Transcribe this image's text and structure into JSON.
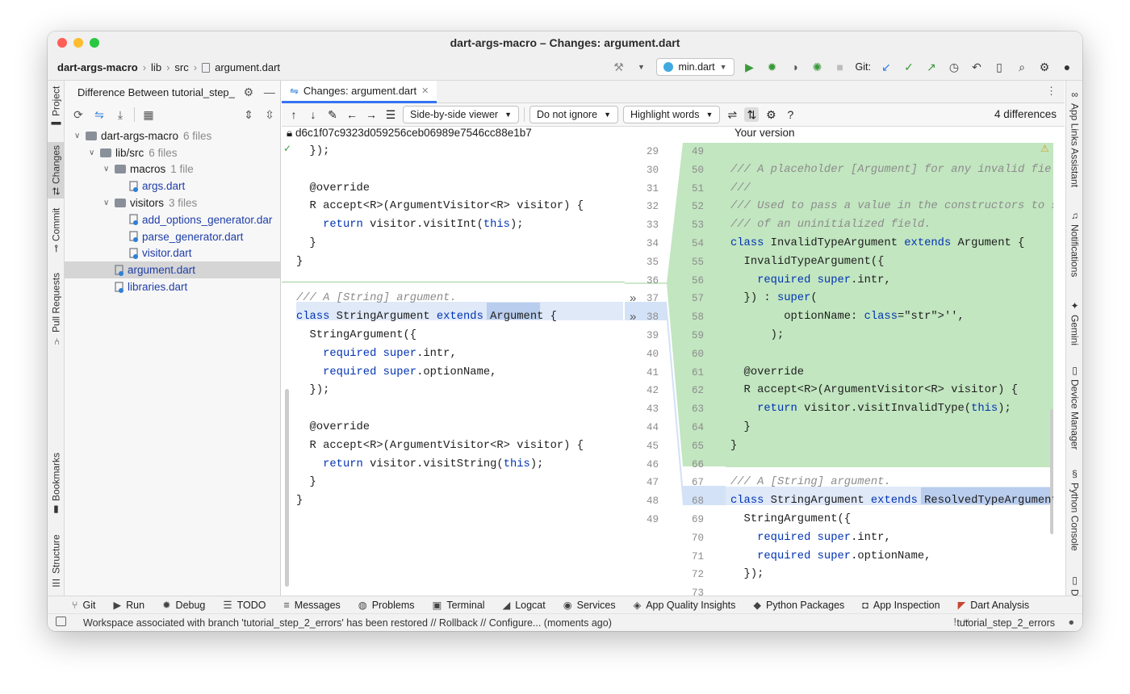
{
  "window": {
    "title": "dart-args-macro – Changes: argument.dart",
    "colors": {
      "close": "#ff5f57",
      "minimize": "#febc2e",
      "zoom": "#28c840",
      "accent": "#3574f0",
      "added_bg": "#c2e6c0",
      "changed_bg": "#d4e2f7"
    }
  },
  "breadcrumbs": [
    "dart-args-macro",
    "lib",
    "src",
    "argument.dart"
  ],
  "toolbar": {
    "run_config": "min.dart",
    "git_label": "Git:"
  },
  "left_tools": [
    {
      "label": "Project",
      "icon": "folder-icon"
    },
    {
      "label": "Changes",
      "icon": "changes-icon"
    },
    {
      "label": "Commit",
      "icon": "commit-icon"
    },
    {
      "label": "Pull Requests",
      "icon": "pull-request-icon"
    },
    {
      "label": "Bookmarks",
      "icon": "bookmark-icon"
    },
    {
      "label": "Structure",
      "icon": "structure-icon"
    }
  ],
  "right_tools": [
    {
      "label": "App Links Assistant",
      "icon": "link-icon"
    },
    {
      "label": "Notifications",
      "icon": "bell-icon"
    },
    {
      "label": "Gemini",
      "icon": "sparkle-icon"
    },
    {
      "label": "Device Manager",
      "icon": "device-icon"
    },
    {
      "label": "Python Console",
      "icon": "python-icon"
    },
    {
      "label": "D",
      "icon": "device-icon"
    }
  ],
  "project": {
    "title": "Difference Between tutorial_step_",
    "tree": [
      {
        "label": "dart-args-macro",
        "count": "6 files",
        "level": 0,
        "kind": "module",
        "expanded": true
      },
      {
        "label": "lib/src",
        "count": "6 files",
        "level": 1,
        "kind": "folder",
        "expanded": true
      },
      {
        "label": "macros",
        "count": "1 file",
        "level": 2,
        "kind": "folder",
        "expanded": true
      },
      {
        "label": "args.dart",
        "count": "",
        "level": 3,
        "kind": "file"
      },
      {
        "label": "visitors",
        "count": "3 files",
        "level": 2,
        "kind": "folder",
        "expanded": true
      },
      {
        "label": "add_options_generator.dar",
        "count": "",
        "level": 3,
        "kind": "file"
      },
      {
        "label": "parse_generator.dart",
        "count": "",
        "level": 3,
        "kind": "file"
      },
      {
        "label": "visitor.dart",
        "count": "",
        "level": 3,
        "kind": "file"
      },
      {
        "label": "argument.dart",
        "count": "",
        "level": 2,
        "kind": "file",
        "selected": true
      },
      {
        "label": "libraries.dart",
        "count": "",
        "level": 2,
        "kind": "file"
      }
    ]
  },
  "editor_tab": {
    "label": "Changes: argument.dart"
  },
  "diff_toolbar": {
    "viewer": "Side-by-side viewer",
    "whitespace": "Do not ignore",
    "highlight": "Highlight words",
    "help": "?",
    "differences": "4 differences"
  },
  "left_pane": {
    "header": "d6c1f07c9323d059256ceb06989e7546cc88e1b7",
    "line_numbers": [
      "29",
      "30",
      "31",
      "32",
      "33",
      "34",
      "35",
      "36",
      "37",
      "38",
      "39",
      "40",
      "41",
      "42",
      "43",
      "44",
      "45",
      "46",
      "47",
      "48",
      "49"
    ],
    "lines": [
      "  });",
      "",
      "  @override",
      "  R accept<R>(ArgumentVisitor<R> visitor) {",
      "    return visitor.visitInt(this);",
      "  }",
      "}",
      "",
      "/// A [String] argument.",
      "class StringArgument extends Argument {",
      "  StringArgument({",
      "    required super.intr,",
      "    required super.optionName,",
      "  });",
      "",
      "  @override",
      "  R accept<R>(ArgumentVisitor<R> visitor) {",
      "    return visitor.visitString(this);",
      "  }",
      "}",
      ""
    ]
  },
  "right_pane": {
    "header": "Your version",
    "line_numbers": [
      "49",
      "50",
      "51",
      "52",
      "53",
      "54",
      "55",
      "56",
      "57",
      "58",
      "59",
      "60",
      "61",
      "62",
      "63",
      "64",
      "65",
      "66",
      "67",
      "68",
      "69",
      "70",
      "71",
      "72",
      "73"
    ],
    "lines": [
      "",
      "/// A placeholder [Argument] for any invalid field.",
      "///",
      "/// Used to pass a value in the constructors to sile",
      "/// of an uninitialized field.",
      "class InvalidTypeArgument extends Argument {",
      "  InvalidTypeArgument({",
      "    required super.intr,",
      "  }) : super(",
      "        optionName: '',",
      "      );",
      "",
      "  @override",
      "  R accept<R>(ArgumentVisitor<R> visitor) {",
      "    return visitor.visitInvalidType(this);",
      "  }",
      "}",
      "",
      "/// A [String] argument.",
      "class StringArgument extends ResolvedTypeArgument {",
      "  StringArgument({",
      "    required super.intr,",
      "    required super.optionName,",
      "  });",
      ""
    ]
  },
  "bottom_tools": [
    {
      "label": "Git",
      "icon": "git-icon"
    },
    {
      "label": "Run",
      "icon": "run-icon"
    },
    {
      "label": "Debug",
      "icon": "bug-icon"
    },
    {
      "label": "TODO",
      "icon": "list-icon"
    },
    {
      "label": "Messages",
      "icon": "messages-icon"
    },
    {
      "label": "Problems",
      "icon": "problems-icon"
    },
    {
      "label": "Terminal",
      "icon": "terminal-icon"
    },
    {
      "label": "Logcat",
      "icon": "logcat-icon"
    },
    {
      "label": "Services",
      "icon": "services-icon"
    },
    {
      "label": "App Quality Insights",
      "icon": "diamond-icon"
    },
    {
      "label": "Python Packages",
      "icon": "layers-icon"
    },
    {
      "label": "App Inspection",
      "icon": "inspect-icon"
    },
    {
      "label": "Dart Analysis",
      "icon": "dart-icon"
    }
  ],
  "status": {
    "message": "Workspace associated with branch 'tutorial_step_2_errors' has been restored // Rollback // Configure... (moments ago)",
    "branch": "tutorial_step_2_errors"
  }
}
